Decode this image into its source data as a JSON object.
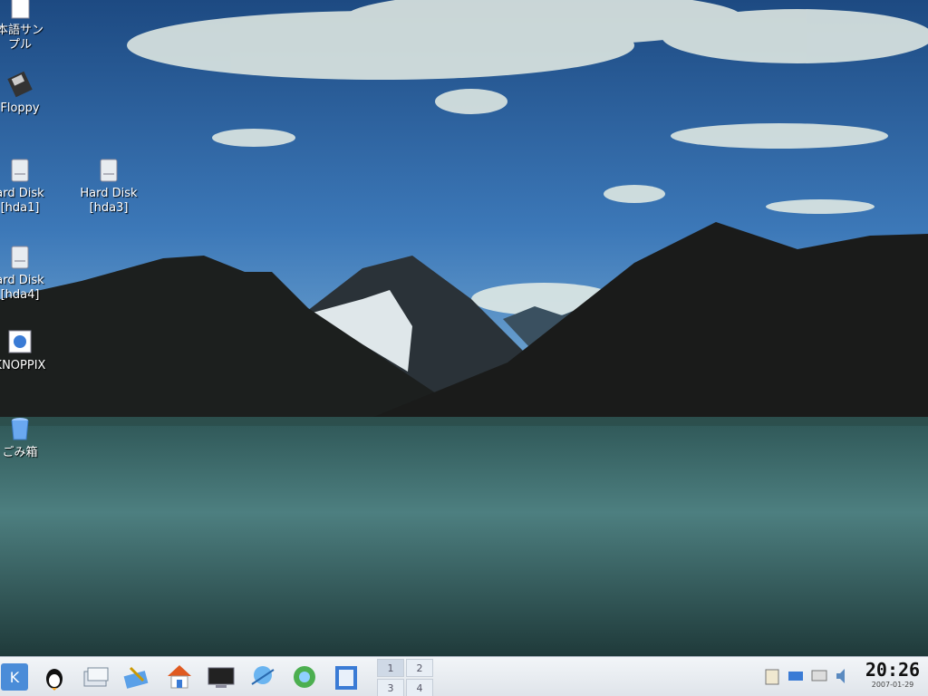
{
  "desktop": {
    "icons": [
      {
        "label": "本語サン\nプル",
        "icon": "document-icon"
      },
      {
        "label": "Floppy",
        "icon": "floppy-icon"
      },
      {
        "label": "ard Disk\n[hda1]",
        "icon": "hard-disk-icon"
      },
      {
        "label": "Hard Disk\n[hda3]",
        "icon": "hard-disk-icon"
      },
      {
        "label": "ard Disk\n[hda4]",
        "icon": "hard-disk-icon"
      },
      {
        "label": "KNOPPIX",
        "icon": "knoppix-icon"
      },
      {
        "label": "ごみ箱",
        "icon": "trash-icon"
      }
    ]
  },
  "taskbar": {
    "launchers": [
      "kde-menu-icon",
      "penguin-icon",
      "window-list-icon",
      "edit-icon",
      "home-icon",
      "terminal-icon",
      "network-icon",
      "browser-icon",
      "help-icon"
    ],
    "pager": {
      "desktops": [
        "1",
        "2",
        "3",
        "4"
      ],
      "active": "1"
    },
    "tray_icons": [
      "clipboard-icon",
      "network-tray-icon",
      "monitor-icon",
      "volume-icon"
    ],
    "clock": {
      "time": "20:26",
      "date": "2007-01-29"
    }
  },
  "colors": {
    "sky": "#3c78b4",
    "water": "#3f6c6c",
    "mountain": "#1a1d1a",
    "taskbar": "#e6eaef"
  }
}
